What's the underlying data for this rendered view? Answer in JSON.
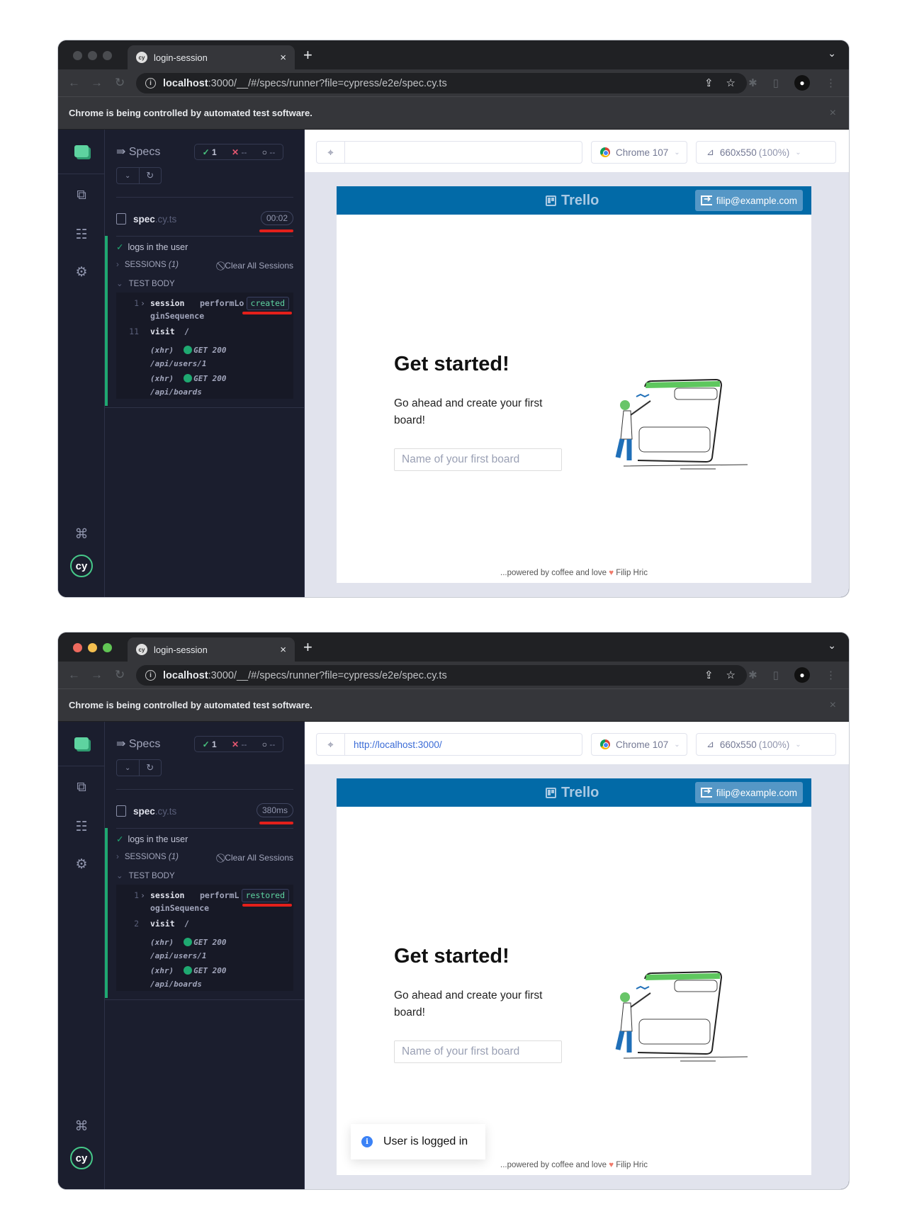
{
  "windows": [
    {
      "tab": {
        "title": "login-session",
        "favicon": "cypress-icon",
        "close": "×",
        "new_tab": "+"
      },
      "address": {
        "host": "localhost",
        "rest": ":3000/__/#/specs/runner?file=cypress/e2e/spec.cy.ts"
      },
      "infobar": {
        "message": "Chrome is being controlled by automated test software.",
        "close": "×"
      },
      "reporter": {
        "specs_label": "Specs",
        "stats": {
          "passed": "1",
          "failed": "--",
          "pending": "--"
        },
        "spec": {
          "name": "spec",
          "ext": ".cy.ts",
          "duration": "00:02"
        },
        "test": {
          "title": "logs in the user",
          "sessions_label": "SESSIONS",
          "sessions_count": "(1)",
          "clear_sessions": "Clear All Sessions",
          "test_body_label": "TEST BODY",
          "commands": [
            {
              "num": "1",
              "name": "session",
              "message": "performLo",
              "message_cont": "ginSequence",
              "badge": "created"
            },
            {
              "num": "11",
              "name": "visit",
              "message": "/"
            }
          ],
          "requests": [
            {
              "type": "(xhr)",
              "method": "GET 200",
              "path": "/api/users/1"
            },
            {
              "type": "(xhr)",
              "method": "GET 200",
              "path": "/api/boards"
            }
          ]
        }
      },
      "aut": {
        "url": "",
        "browser": "Chrome 107",
        "viewport": "660x550",
        "viewport_pct": "(100%)"
      },
      "toast": null
    },
    {
      "tab": {
        "title": "login-session",
        "favicon": "cypress-icon",
        "close": "×",
        "new_tab": "+"
      },
      "address": {
        "host": "localhost",
        "rest": ":3000/__/#/specs/runner?file=cypress/e2e/spec.cy.ts"
      },
      "infobar": {
        "message": "Chrome is being controlled by automated test software.",
        "close": "×"
      },
      "reporter": {
        "specs_label": "Specs",
        "stats": {
          "passed": "1",
          "failed": "--",
          "pending": "--"
        },
        "spec": {
          "name": "spec",
          "ext": ".cy.ts",
          "duration": "380ms"
        },
        "test": {
          "title": "logs in the user",
          "sessions_label": "SESSIONS",
          "sessions_count": "(1)",
          "clear_sessions": "Clear All Sessions",
          "test_body_label": "TEST BODY",
          "commands": [
            {
              "num": "1",
              "name": "session",
              "message": "performL",
              "message_cont": "oginSequence",
              "badge": "restored"
            },
            {
              "num": "2",
              "name": "visit",
              "message": "/"
            }
          ],
          "requests": [
            {
              "type": "(xhr)",
              "method": "GET 200",
              "path": "/api/users/1"
            },
            {
              "type": "(xhr)",
              "method": "GET 200",
              "path": "/api/boards"
            }
          ]
        }
      },
      "aut": {
        "url": "http://localhost:3000/",
        "browser": "Chrome 107",
        "viewport": "660x550",
        "viewport_pct": "(100%)"
      },
      "toast": {
        "message": "User is logged in",
        "icon": "info-icon"
      }
    }
  ],
  "trello": {
    "brand": "Trello",
    "user_email": "filip@example.com",
    "heading": "Get started!",
    "description": "Go ahead and create your first board!",
    "board_input_placeholder": "Name of your first board",
    "footer_prefix": "...powered by coffee and love",
    "footer_author": "Filip Hric"
  },
  "colors": {
    "trello_blue": "#026aa7",
    "pass_green": "#1fa971",
    "fail_red": "#e45770",
    "annotation_red": "#e3201b"
  }
}
